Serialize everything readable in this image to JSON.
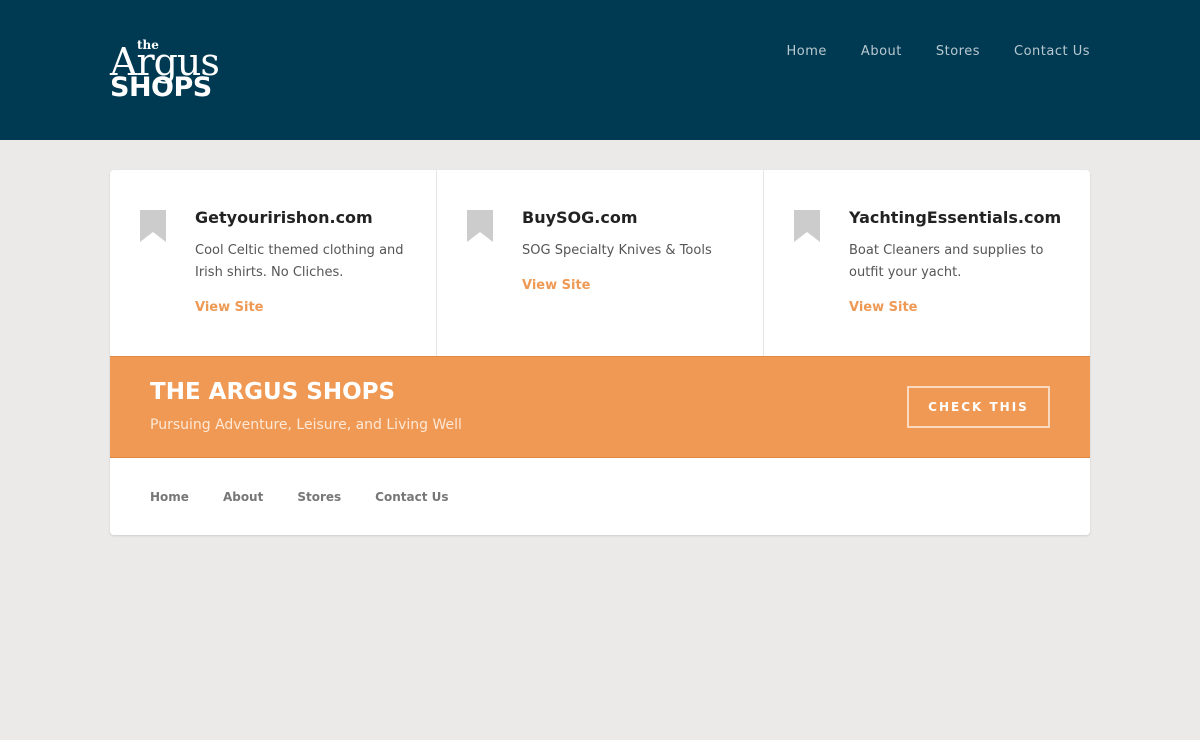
{
  "brand": {
    "the": "the",
    "argus": "Argus",
    "shops": "SHOPS"
  },
  "header_nav": [
    "Home",
    "About",
    "Stores",
    "Contact Us"
  ],
  "features": [
    {
      "title": "Getyouririshon.com",
      "description": "Cool Celtic themed clothing and Irish shirts. No Cliches.",
      "link": "View Site",
      "icon": "bookmark-icon"
    },
    {
      "title": "BuySOG.com",
      "description": "SOG Specialty Knives & Tools",
      "link": "View Site",
      "icon": "bookmark-icon"
    },
    {
      "title": "YachtingEssentials.com",
      "description": "Boat Cleaners and supplies to outfit your yacht.",
      "link": "View Site",
      "icon": "bookmark-icon"
    }
  ],
  "banner": {
    "title": "THE ARGUS SHOPS",
    "subtitle": "Pursuing Adventure, Leisure, and Living Well",
    "button": "CHECK THIS"
  },
  "footer_nav": [
    "Home",
    "About",
    "Stores",
    "Contact Us"
  ],
  "colors": {
    "header_bg": "#003a52",
    "accent": "#ef9954",
    "page_bg": "#ebeae8"
  }
}
